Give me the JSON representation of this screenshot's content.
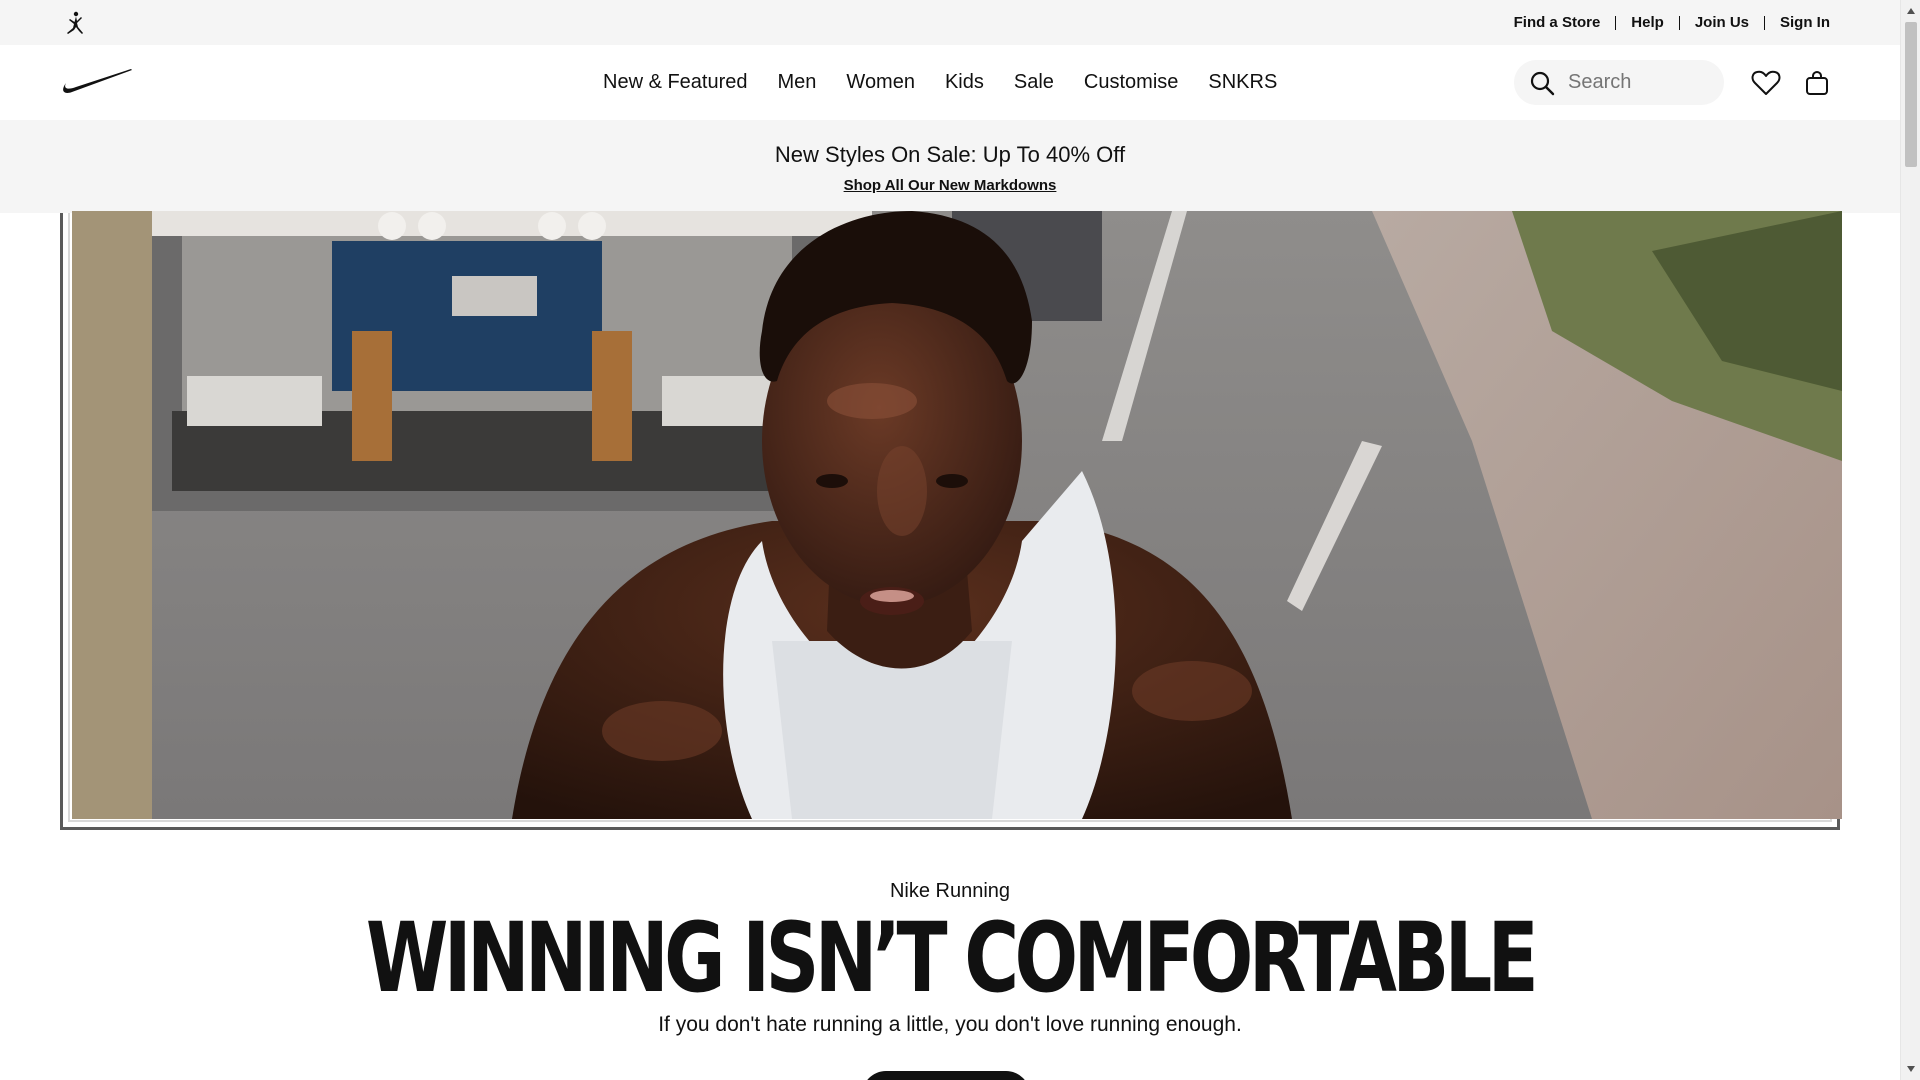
{
  "utility_bar": {
    "links": [
      "Find a Store",
      "Help",
      "Join Us",
      "Sign In"
    ]
  },
  "nav": {
    "items": [
      "New & Featured",
      "Men",
      "Women",
      "Kids",
      "Sale",
      "Customise",
      "SNKRS"
    ],
    "search_placeholder": "Search"
  },
  "promo": {
    "title": "New Styles On Sale: Up To 40% Off",
    "link": "Shop All Our New Markdowns"
  },
  "hero": {
    "eyebrow": "Nike Running",
    "headline": "WINNING ISN’T COMFORTABLE",
    "subheading": "If you don't hate running a little, you don't love running enough."
  },
  "icons": {
    "brand_logo": "nike-swoosh",
    "sub_brand_logo": "jordan-jumpman",
    "search": "search-icon",
    "favourites": "heart-icon",
    "bag": "bag-icon"
  },
  "colors": {
    "text": "#111111",
    "utility_bg": "#f5f5f5",
    "cta_bg": "#111111"
  }
}
